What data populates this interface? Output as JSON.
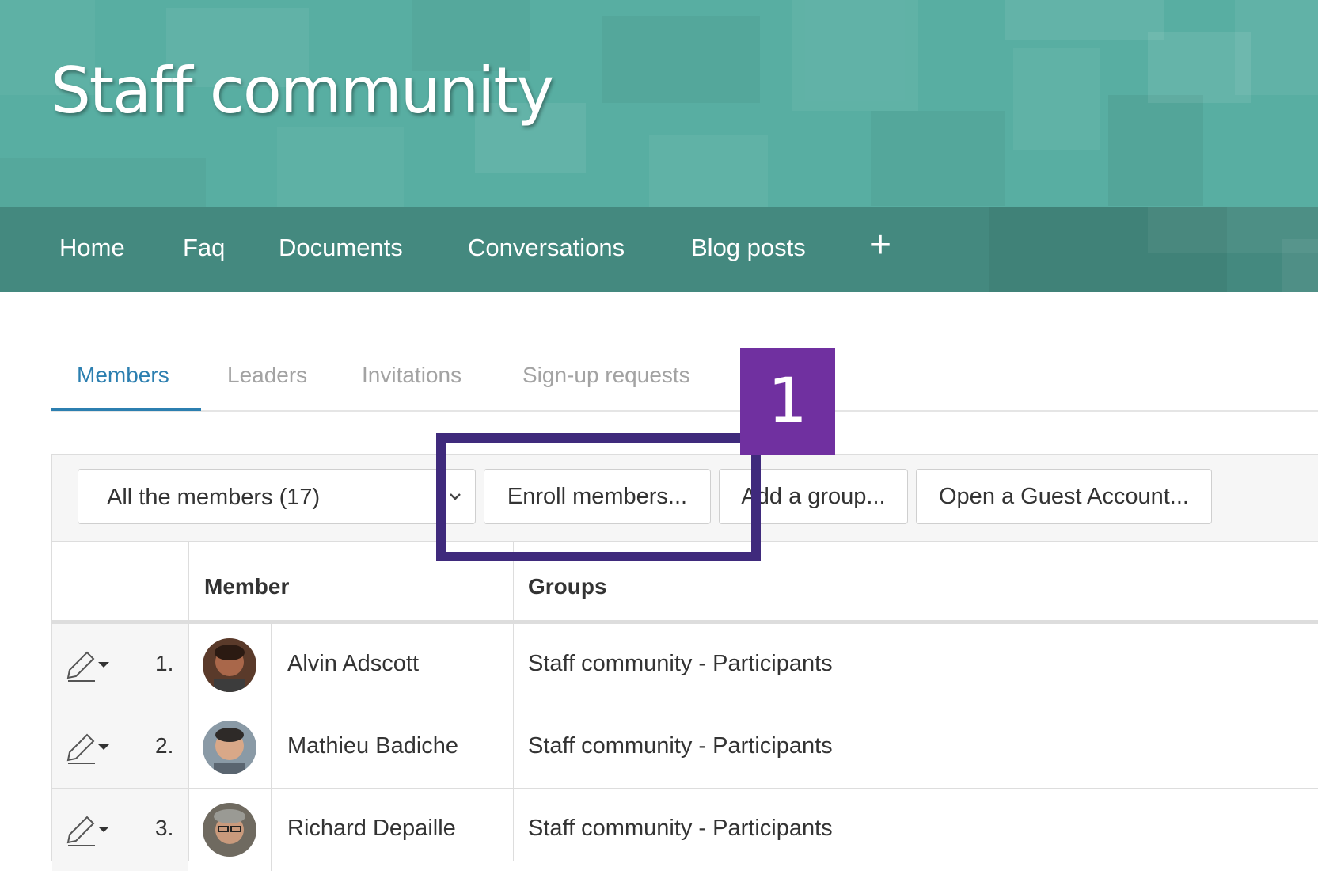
{
  "header": {
    "title": "Staff community",
    "color": "#58aea2"
  },
  "nav": {
    "items": [
      {
        "label": "Home"
      },
      {
        "label": "Faq"
      },
      {
        "label": "Documents"
      },
      {
        "label": "Conversations"
      },
      {
        "label": "Blog posts"
      }
    ],
    "add_label": "+",
    "color": "#44897f"
  },
  "tabs": [
    {
      "label": "Members",
      "active": true
    },
    {
      "label": "Leaders",
      "active": false
    },
    {
      "label": "Invitations",
      "active": false
    },
    {
      "label": "Sign-up requests",
      "active": false
    }
  ],
  "toolbar": {
    "filter_value": "All the members (17)",
    "enroll_label": "Enroll members...",
    "add_group_label": "Add a group...",
    "guest_label": "Open a Guest Account..."
  },
  "table": {
    "columns": [
      "Member",
      "Groups"
    ],
    "rows": [
      {
        "index": "1.",
        "name": "Alvin Adscott",
        "group": "Staff community - Participants",
        "avatar": "avatar-icon"
      },
      {
        "index": "2.",
        "name": "Mathieu Badiche",
        "group": "Staff community - Participants",
        "avatar": "avatar-icon"
      },
      {
        "index": "3.",
        "name": "Richard Depaille",
        "group": "Staff community - Participants",
        "avatar": "avatar-icon"
      }
    ]
  },
  "annotation": {
    "badge": "1",
    "color": "#7030a0"
  },
  "colors": {
    "accent": "#2c7fb0",
    "tab_inactive": "#a3a3a3"
  }
}
